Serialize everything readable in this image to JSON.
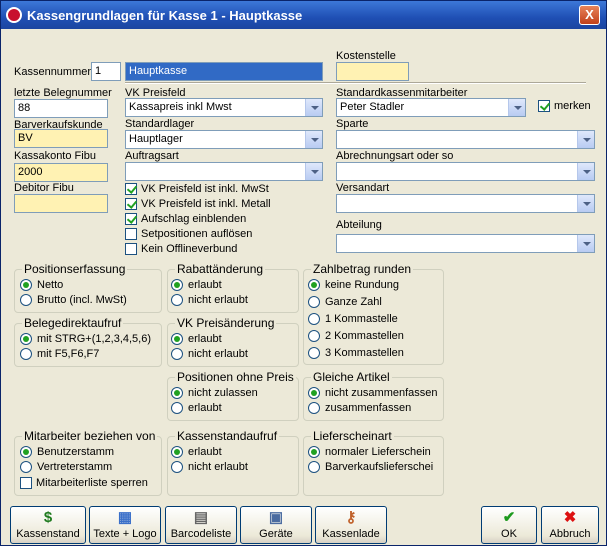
{
  "window": {
    "title": "Kassengrundlagen für Kasse 1 - Hauptkasse",
    "close": "X"
  },
  "left": {
    "kassennummer_label": "Kassennummer",
    "kassennummer": "1",
    "kassenname": "Hauptkasse",
    "letzte_beleg_label": "letzte Belegnummer",
    "letzte_beleg": "88",
    "barverkauf_label": "Barverkaufskunde",
    "barverkauf": "BV",
    "kassakonto_label": "Kassakonto Fibu",
    "kassakonto": "2000",
    "debitor_label": "Debitor Fibu",
    "debitor": ""
  },
  "middle": {
    "vk_preisfeld_label": "VK Preisfeld",
    "vk_preisfeld": "Kassapreis inkl Mwst",
    "standardlager_label": "Standardlager",
    "standardlager": "Hauptlager",
    "auftragsart_label": "Auftragsart",
    "auftragsart": "",
    "checks": [
      {
        "label": "VK Preisfeld  ist inkl. MwSt",
        "checked": true
      },
      {
        "label": "VK Preisfeld  ist inkl. Metall",
        "checked": true
      },
      {
        "label": "Aufschlag einblenden",
        "checked": true
      },
      {
        "label": "Setpositionen auflösen",
        "checked": false
      },
      {
        "label": "Kein Offlineverbund",
        "checked": false
      }
    ]
  },
  "right": {
    "kostenstelle_label": "Kostenstelle",
    "kostenstelle": "",
    "mitarbeiter_label": "Standardkassenmitarbeiter",
    "mitarbeiter": "Peter Stadler",
    "merken": "merken",
    "sparte_label": "Sparte",
    "sparte": "",
    "abrechnung_label": "Abrechnungsart oder so",
    "abrechnung": "",
    "versandart_label": "Versandart",
    "versandart": "",
    "abteilung_label": "Abteilung",
    "abteilung": ""
  },
  "groups": {
    "positionserfassung": {
      "title": "Positionserfassung",
      "options": [
        "Netto",
        "Brutto (incl. MwSt)"
      ]
    },
    "rabatt": {
      "title": "Rabattänderung",
      "options": [
        "erlaubt",
        "nicht erlaubt"
      ]
    },
    "zahlbetrag": {
      "title": "Zahlbetrag runden",
      "options": [
        "keine Rundung",
        "Ganze Zahl",
        "1 Kommastelle",
        "2 Kommastellen",
        "3 Kommastellen"
      ]
    },
    "belegdirekt": {
      "title": "Belegedirektaufruf",
      "options": [
        "mit STRG+(1,2,3,4,5,6)",
        "mit F5,F6,F7"
      ]
    },
    "vkpreis": {
      "title": "VK Preisänderung",
      "options": [
        "erlaubt",
        "nicht erlaubt"
      ]
    },
    "ohnepreis": {
      "title": "Positionen ohne Preis",
      "options": [
        "nicht zulassen",
        "erlaubt"
      ]
    },
    "gleiche": {
      "title": "Gleiche Artikel",
      "options": [
        "nicht zusammenfassen",
        "zusammenfassen"
      ]
    },
    "mitarbeiter": {
      "title": "Mitarbeiter beziehen von",
      "options": [
        "Benutzerstamm",
        "Vertreterstamm"
      ],
      "check": "Mitarbeiterliste sperren"
    },
    "kassenstand": {
      "title": "Kassenstandaufruf",
      "options": [
        "erlaubt",
        "nicht erlaubt"
      ]
    },
    "lieferschein": {
      "title": "Lieferscheinart",
      "options": [
        "normaler Lieferschein",
        "Barverkaufslieferschei"
      ]
    }
  },
  "buttons": {
    "kassenstand": "Kassenstand",
    "texte": "Texte + Logo",
    "barcode": "Barcodeliste",
    "geraete": "Geräte",
    "kassenlade": "Kassenlade",
    "ok": "OK",
    "abbruch": "Abbruch"
  },
  "colors": {
    "titlebar": "#1f4fb4",
    "dialog": "#ece9d8",
    "yellow_field": "#fff2b3",
    "radio_on": "#21a121"
  }
}
